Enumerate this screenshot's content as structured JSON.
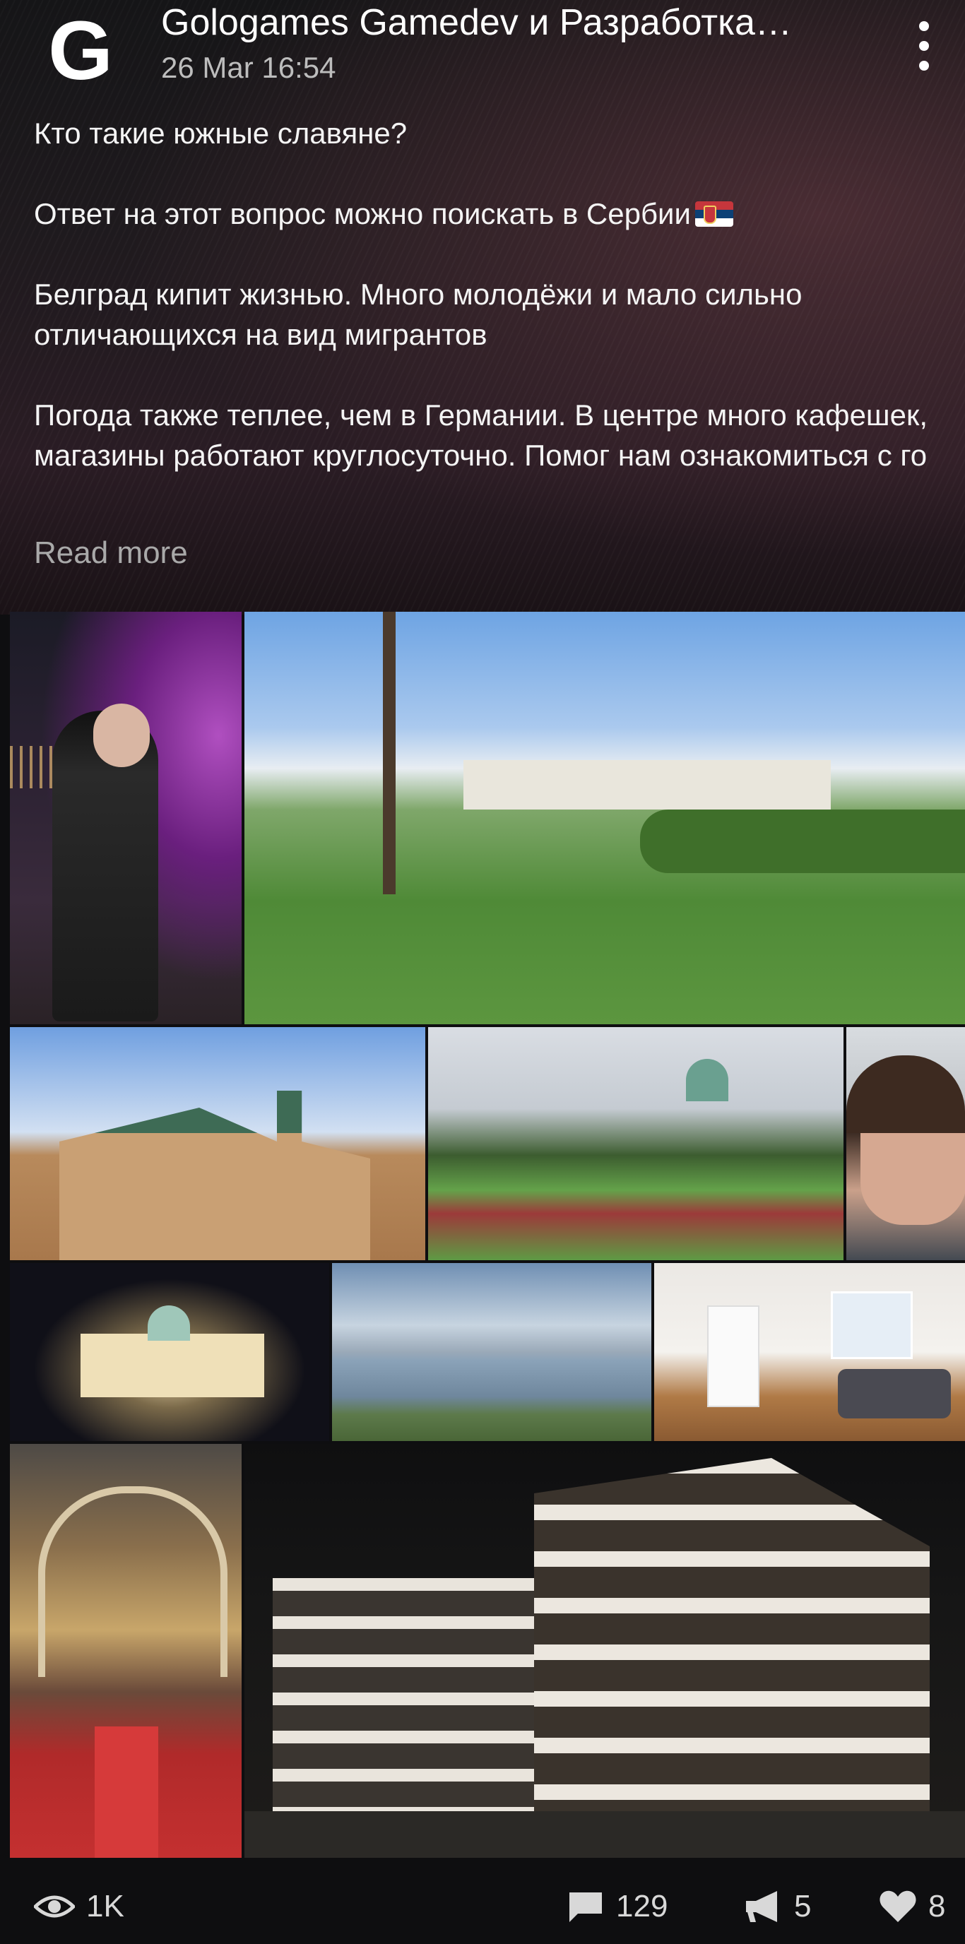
{
  "post": {
    "channel_name": "Gologames Gamedev и Разработка…",
    "avatar_letter": "G",
    "date": "26 Mar 16:54",
    "paragraphs": [
      "Кто такие южные славяне?",
      "Ответ на этот вопрос можно поискать в Сербии",
      "Белград кипит жизнью. Много молодёжи и мало сильно отличающихся на вид мигрантов",
      "Погода также теплее, чем в Германии. В центре много кафешек, магазины работают круглосуточно. Помог нам ознакомиться с го"
    ],
    "read_more": "Read more"
  },
  "stats": {
    "views": "1K",
    "comments": "129",
    "reposts": "5",
    "likes": "8"
  },
  "colors": {
    "background": "#0e0e10",
    "text": "#f4f4f4",
    "muted": "#a9a9a9"
  },
  "icons": [
    "more-vertical-icon",
    "eye-icon",
    "comment-icon",
    "repost-megaphone-icon",
    "heart-icon",
    "serbia-flag-icon"
  ]
}
